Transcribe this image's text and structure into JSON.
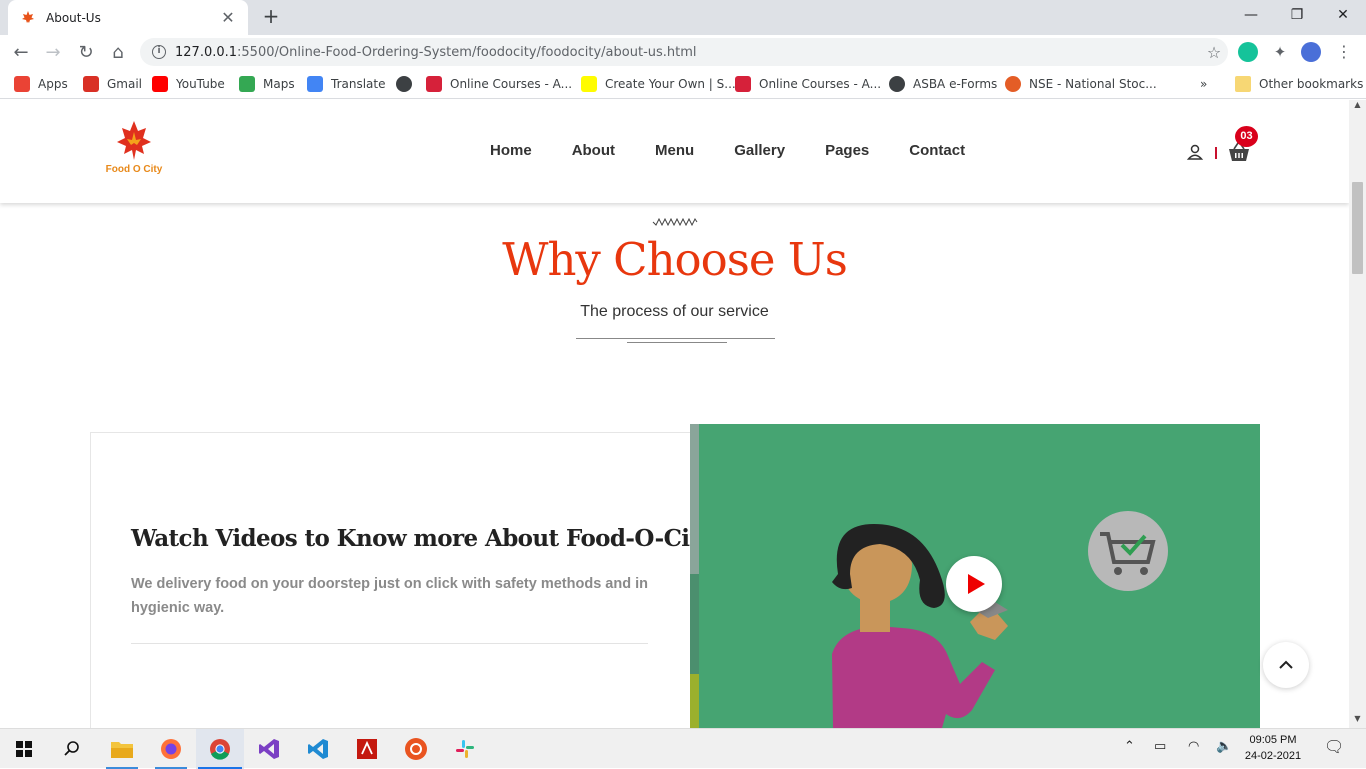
{
  "browser": {
    "tab_title": "About-Us",
    "url_host": "127.0.0.1",
    "url_rest": ":5500/Online-Food-Ordering-System/foodocity/foodocity/about-us.html",
    "bookmarks": [
      {
        "label": "Apps",
        "icon": "apps-grid-icon",
        "color": "#ea4335"
      },
      {
        "label": "Gmail",
        "icon": "gmail-icon",
        "color": "#d93025"
      },
      {
        "label": "YouTube",
        "icon": "youtube-icon",
        "color": "#ff0000"
      },
      {
        "label": "Maps",
        "icon": "maps-icon",
        "color": "#34a853"
      },
      {
        "label": "Translate",
        "icon": "translate-icon",
        "color": "#4285f4"
      },
      {
        "label": "",
        "icon": "globe-icon",
        "color": "#3c4043"
      },
      {
        "label": "Online Courses - A...",
        "icon": "udemy-icon",
        "color": "#d6213a"
      },
      {
        "label": "Create Your Own | S...",
        "icon": "snapchat-icon",
        "color": "#fffc00"
      },
      {
        "label": "Online Courses - A...",
        "icon": "udemy-icon",
        "color": "#d6213a"
      },
      {
        "label": "ASBA e-Forms",
        "icon": "globe-icon",
        "color": "#3c4043"
      },
      {
        "label": "NSE - National Stoc...",
        "icon": "nse-icon",
        "color": "#e45d26"
      }
    ],
    "other_bookmarks": "Other bookmarks",
    "overflow": "»"
  },
  "site": {
    "logo_text": "Food O City",
    "nav": [
      "Home",
      "About",
      "Menu",
      "Gallery",
      "Pages",
      "Contact"
    ],
    "cart_count": "03",
    "accent_color": "#e8370e"
  },
  "section": {
    "title": "Why Choose Us",
    "subtitle": "The process of our service"
  },
  "card": {
    "title": "Watch Videos to Know more About Food-O-City",
    "text": "We delivery food on your doorstep just on click with safety methods and in hygienic way."
  },
  "taskbar": {
    "time": "09:05 PM",
    "date": "24-02-2021"
  }
}
